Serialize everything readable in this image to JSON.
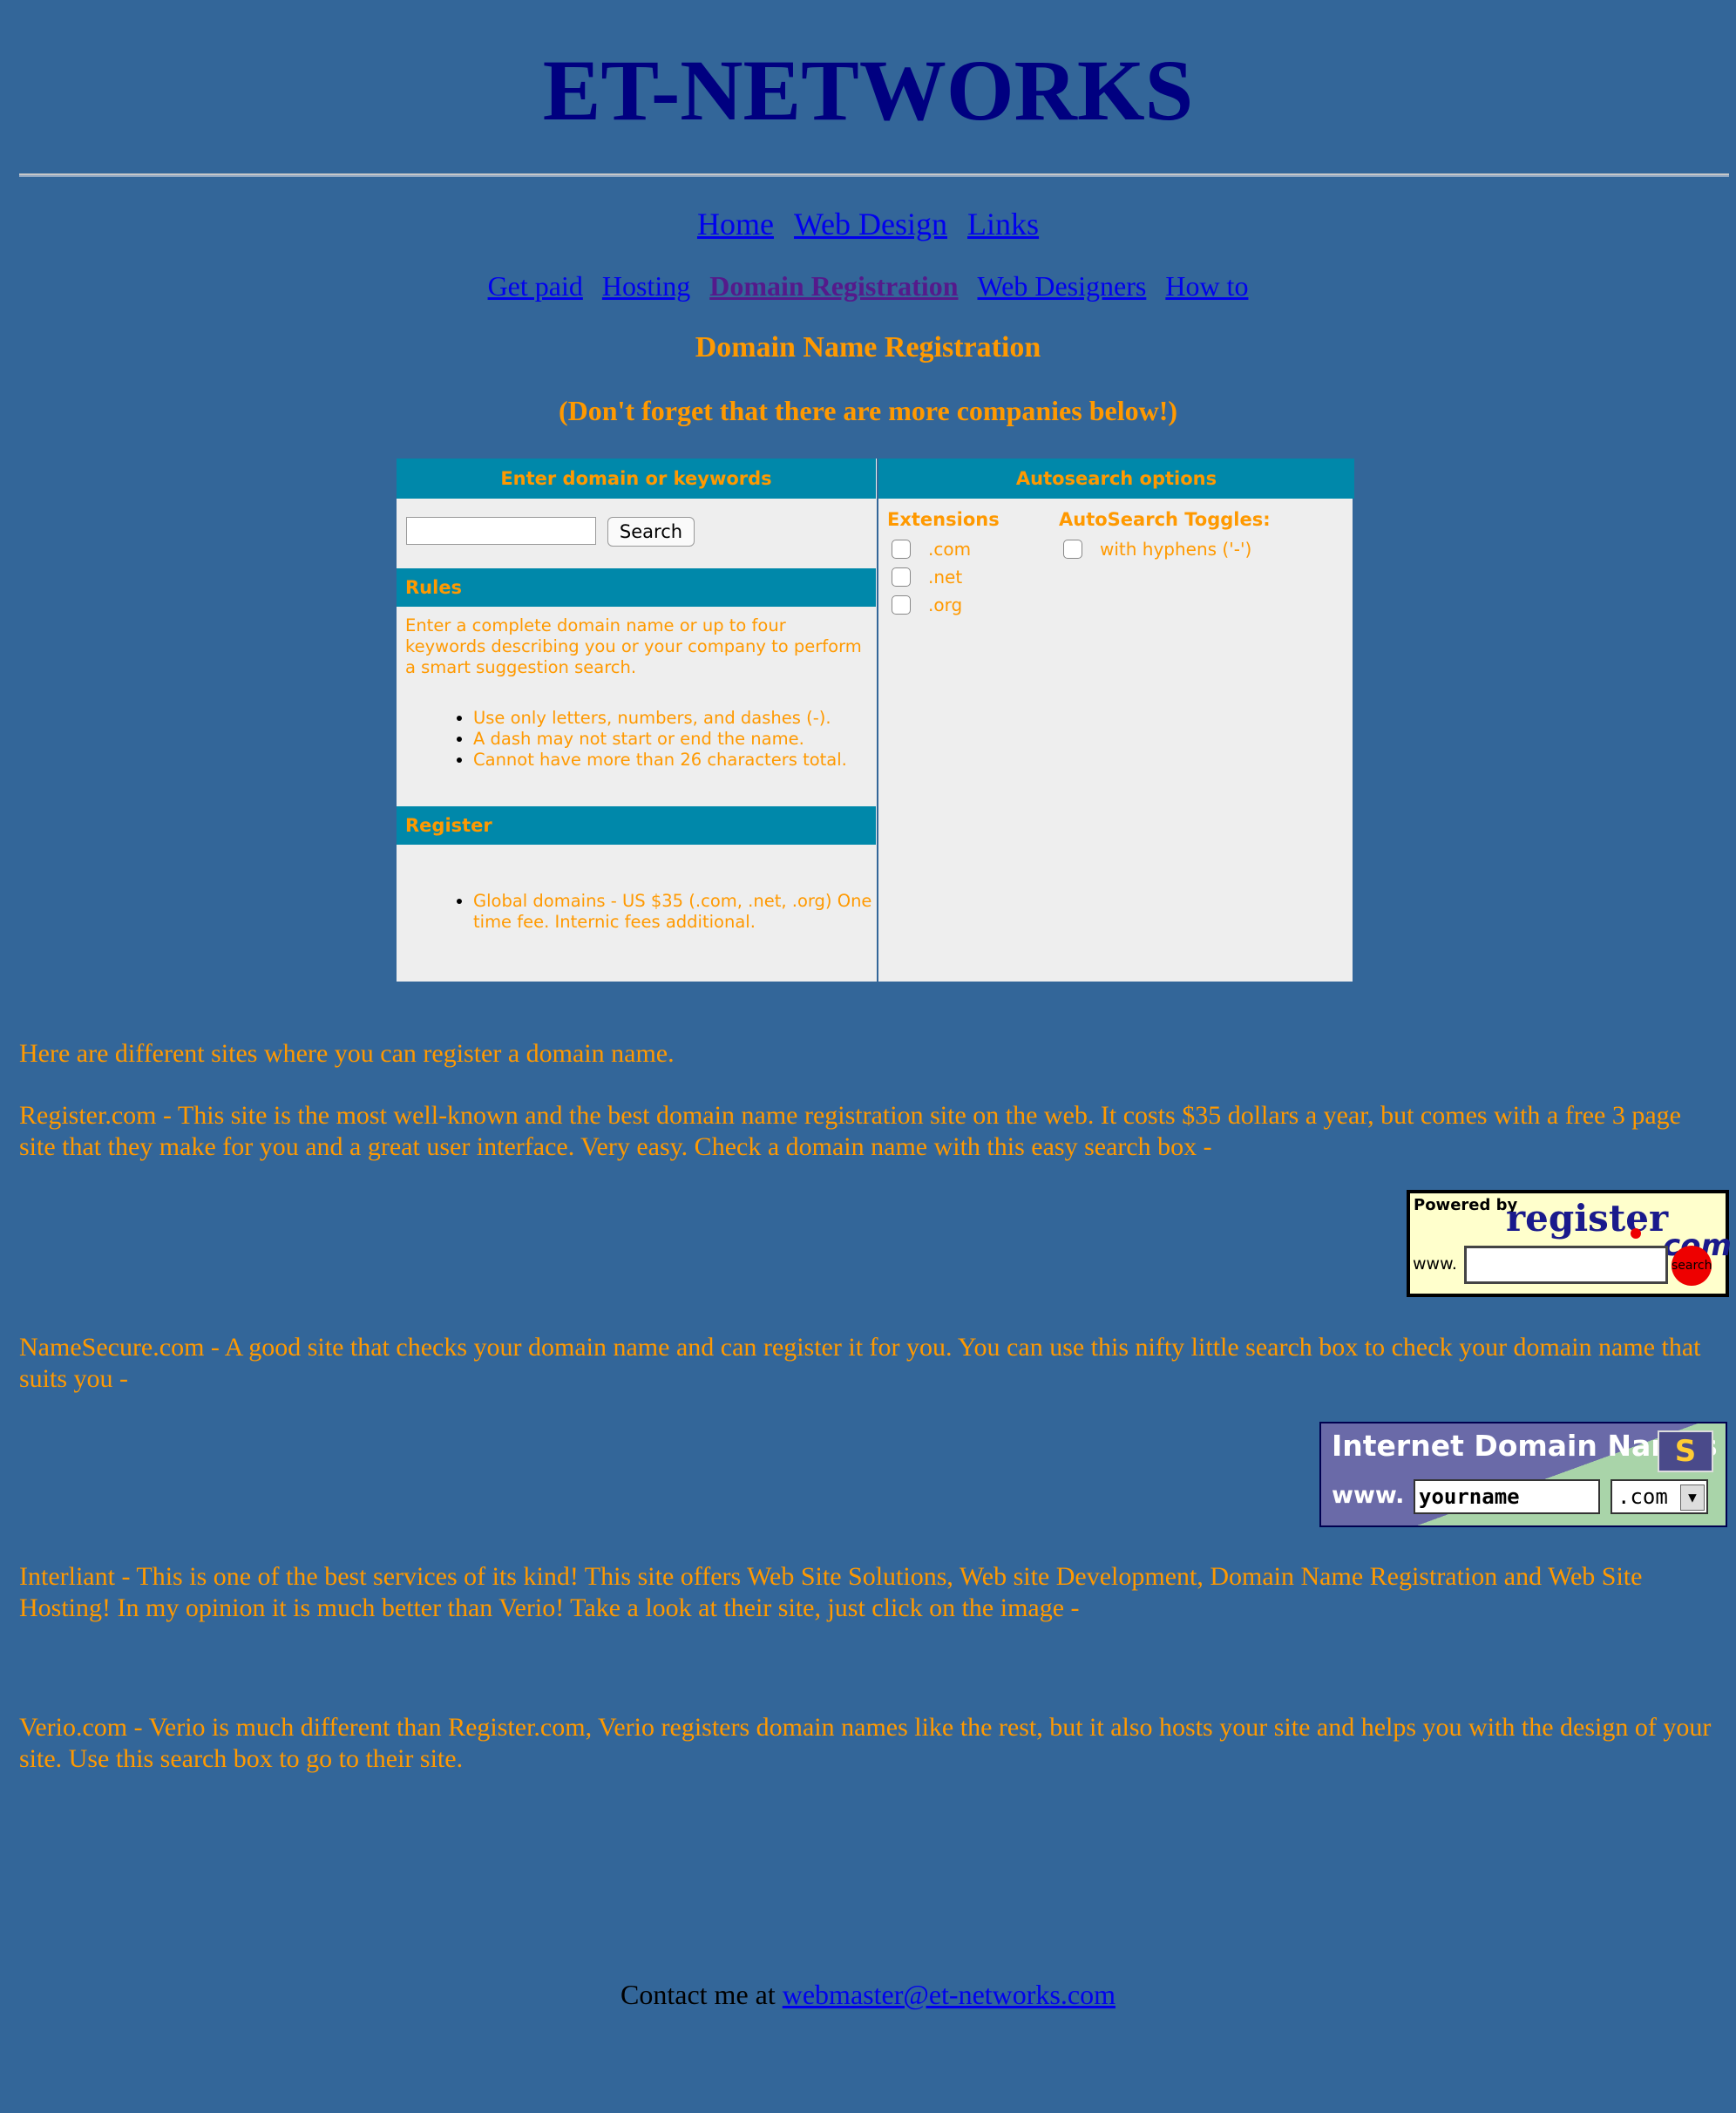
{
  "site": {
    "title": "ET-NETWORKS"
  },
  "nav_primary": [
    "Home",
    "Web Design",
    "Links"
  ],
  "nav_secondary": [
    "Get paid",
    "Hosting",
    "Domain Registration",
    "Web Designers",
    "How to"
  ],
  "headings": {
    "main": "Domain Name Registration",
    "note": "(Don't forget that there are more companies below!)"
  },
  "widget": {
    "left_header": "Enter domain or keywords",
    "right_header": "Autosearch options",
    "search_button": "Search",
    "rules_header": "Rules",
    "rules_text": "Enter a complete domain name or up to four keywords describing you or your company to perform a smart suggestion search.",
    "rules": [
      "Use only letters, numbers, and dashes (-).",
      "A dash may not start or end the name.",
      "Cannot have more than 26 characters total."
    ],
    "register_header": "Register",
    "register_items": [
      "Global domains - US $35 (.com, .net, .org) One time fee. Internic fees additional."
    ],
    "extensions_header": "Extensions",
    "extensions": [
      ".com",
      ".net",
      ".org"
    ],
    "toggles_header": "AutoSearch Toggles:",
    "toggles": [
      "with hyphens ('-')"
    ]
  },
  "paragraphs": {
    "intro": "Here are different sites where you can register a domain name.",
    "register": "Register.com - This site is the most well-known and the best domain name registration site on the web.  It costs $35 dollars a year, but comes with a free 3 page site that they make for you and a great user interface.  Very easy.  Check a domain name with this easy search box -",
    "namesecure": "NameSecure.com - A good site that checks your domain name and can register it for you.  You can use this nifty little search box to check your domain name that suits you -",
    "interliant": "Interliant - This is one of the best services of its kind!  This site offers Web Site Solutions, Web site Development, Domain Name Registration and Web Site Hosting!  In my opinion it is much better than Verio!  Take a look at their site, just click on the image -",
    "verio": "Verio.com - Verio is much different than Register.com, Verio registers domain names like the rest, but it also hosts your site and helps you with the design of your site.  Use this search box to go to their site."
  },
  "register_widget": {
    "powered_by": "Powered by",
    "brand": "register",
    "brand_suffix": "com",
    "www": "www.",
    "go": "search"
  },
  "idn_widget": {
    "title": "Internet Domain Names",
    "logo": "S",
    "www": "www.",
    "input_value": "yourname",
    "select_value": ".com"
  },
  "contact": {
    "prefix": "Contact me at",
    "email": "webmaster@et-networks.com"
  },
  "colors": {
    "background": "#336699",
    "accent": "#FF9900",
    "title": "#000080",
    "widget_header": "#0088AA"
  }
}
